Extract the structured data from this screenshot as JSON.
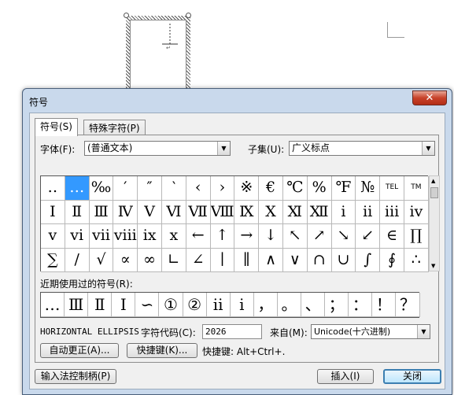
{
  "dialog": {
    "title": "符号",
    "close_label": "✕"
  },
  "tabs": [
    {
      "label": "符号(S)",
      "active": true
    },
    {
      "label": "特殊字符(P)",
      "active": false
    }
  ],
  "font": {
    "label": "字体(F):",
    "value": "(普通文本)"
  },
  "subset": {
    "label": "子集(U):",
    "value": "广义标点"
  },
  "symbol_grid": [
    [
      "‥",
      "…",
      "‰",
      "′",
      "″",
      "‵",
      "‹",
      "›",
      "※",
      "€",
      "℃",
      "%",
      "℉",
      "№",
      "TEL",
      "TM"
    ],
    [
      "Ⅰ",
      "Ⅱ",
      "Ⅲ",
      "Ⅳ",
      "Ⅴ",
      "Ⅵ",
      "Ⅶ",
      "Ⅷ",
      "Ⅸ",
      "Ⅹ",
      "Ⅺ",
      "Ⅻ",
      "ⅰ",
      "ⅱ",
      "ⅲ",
      "ⅳ"
    ],
    [
      "ⅴ",
      "ⅵ",
      "ⅶ",
      "ⅷ",
      "ⅸ",
      "ⅹ",
      "←",
      "↑",
      "→",
      "↓",
      "↖",
      "↗",
      "↘",
      "↙",
      "∈",
      "∏"
    ],
    [
      "∑",
      "∕",
      "√",
      "∝",
      "∞",
      "∟",
      "∠",
      "∣",
      "∥",
      "∧",
      "∨",
      "∩",
      "∪",
      "∫",
      "∮",
      "∴"
    ]
  ],
  "selected_symbol": {
    "row": 0,
    "col": 1
  },
  "recent": {
    "label": "近期使用过的符号(R):",
    "symbols": [
      "…",
      "Ⅲ",
      "Ⅱ",
      "Ⅰ",
      "∽",
      "①",
      "②",
      "ⅱ",
      "ⅰ",
      "，",
      "。",
      "、",
      "；",
      "：",
      "！",
      "？"
    ]
  },
  "char_name": "HORIZONTAL ELLIPSIS",
  "char_code": {
    "label": "字符代码(C):",
    "value": "2026"
  },
  "from": {
    "label": "来自(M):",
    "value": "Unicode(十六进制)"
  },
  "autocorrect_button": "自动更正(A)...",
  "shortcut_key_button": "快捷键(K)...",
  "shortcut_text": "快捷键: Alt+Ctrl+.",
  "ime_button": "输入法控制柄(P)",
  "insert_button": "插入(I)",
  "close_button": "关闭"
}
